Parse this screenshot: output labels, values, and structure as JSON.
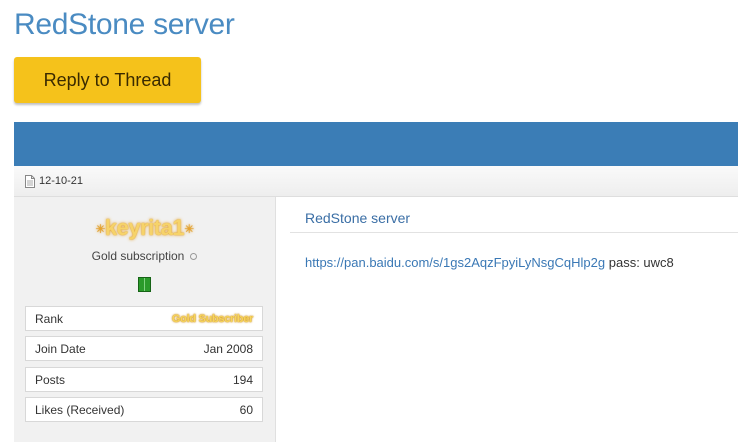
{
  "thread": {
    "title": "RedStone server",
    "reply_label": "Reply to Thread"
  },
  "post": {
    "date": "12-10-21",
    "title": "RedStone server",
    "link": "https://pan.baidu.com/s/1gs2AqzFpyiLyNsgCqHlp2g",
    "pass_text": " pass: uwc8"
  },
  "user": {
    "name": "keyrita1",
    "usertitle": "Gold subscription",
    "info": [
      {
        "label": "Rank",
        "value": "Gold Subscriber"
      },
      {
        "label": "Join Date",
        "value": "Jan 2008"
      },
      {
        "label": "Posts",
        "value": "194"
      },
      {
        "label": "Likes (Received)",
        "value": "60"
      }
    ]
  },
  "icons": {
    "date": "document-icon",
    "status": "offline-status-icon",
    "reputation": "reputation-icon"
  },
  "colors": {
    "accent": "#4a8bc2",
    "button": "#f5c21b",
    "header_bar": "#3b7db6"
  }
}
